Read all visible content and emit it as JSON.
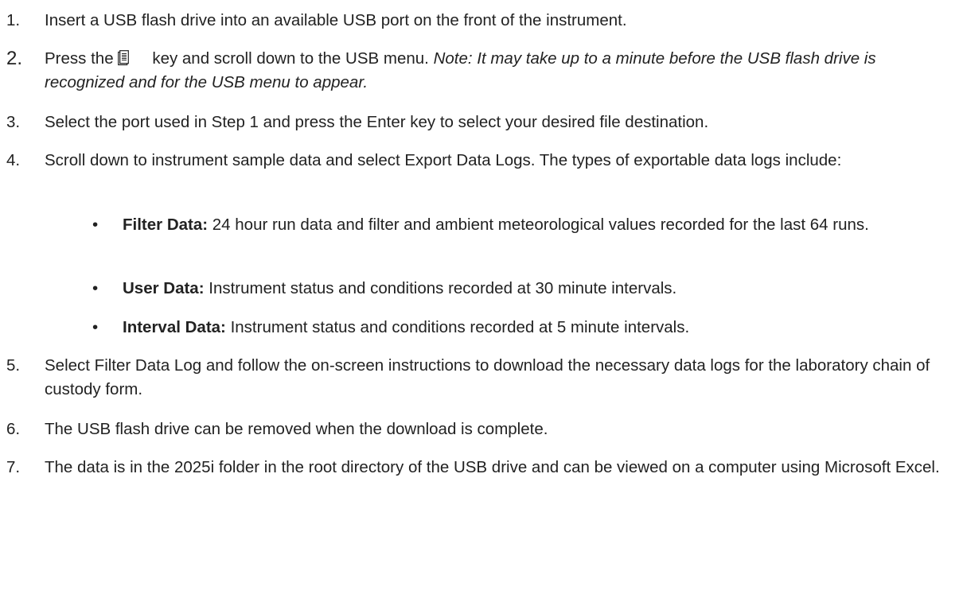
{
  "steps": [
    {
      "number": "1.",
      "text": "Insert a USB flash drive into an available USB port on the front of the instrument."
    },
    {
      "number": "2.",
      "text_before": "Press the",
      "text_after": "key and scroll down to the USB menu.",
      "note": "Note: It may take up to a minute before the USB flash drive is recognized and for the USB menu to appear.",
      "icon": "menu-key-icon"
    },
    {
      "number": "3.",
      "text": "Select the port used in Step 1 and press the Enter key to select your desired file destination."
    },
    {
      "number": "4.",
      "text": "Scroll down to instrument sample data and select Export Data Logs. The types of exportable data logs include:"
    },
    {
      "number": "5.",
      "text": "Select Filter Data Log and follow the on-screen instructions to download the necessary data logs for the laboratory chain of custody form."
    },
    {
      "number": "6.",
      "text": "The USB flash drive can be removed when the download is complete."
    },
    {
      "number": "7.",
      "text": "The data is in the 2025i folder in the root directory of the USB drive and can be viewed on a computer using Microsoft Excel."
    }
  ],
  "bullets": [
    {
      "marker": "•",
      "term": "Filter Data:",
      "text": " 24 hour run data and filter and ambient meteorological values recorded for the last 64 runs."
    },
    {
      "marker": "•",
      "term": "User Data:",
      "text": " Instrument status and conditions recorded at 30 minute intervals."
    },
    {
      "marker": "•",
      "term": "Interval Data:",
      "text": " Instrument status and conditions recorded at 5 minute intervals."
    }
  ]
}
